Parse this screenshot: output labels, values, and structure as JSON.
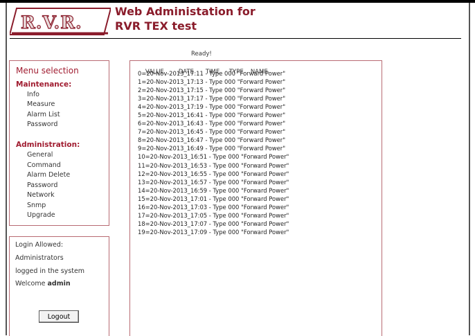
{
  "brand": {
    "logo_text": "R.V.R."
  },
  "header": {
    "title_line1": "Web Administation for",
    "title_line2": "RVR TEX test"
  },
  "status": "Ready!",
  "menu": {
    "title": "Menu selection",
    "maintenance": {
      "heading": "Maintenance:",
      "items": [
        "Info",
        "Measure",
        "Alarm List",
        "Password"
      ]
    },
    "administration": {
      "heading": "Administration:",
      "items": [
        "General",
        "Command",
        "Alarm Delete",
        "Password",
        "Network",
        "Snmp",
        "Upgrade"
      ]
    }
  },
  "login": {
    "line1": "Login Allowed:",
    "line2": "Administrators",
    "line3": "logged in the system",
    "welcome_prefix": "Welcome",
    "username": "admin",
    "logout_label": "Logout"
  },
  "log": {
    "columns": [
      "VALUE",
      "DATE",
      "TIME",
      "TYPE",
      "NAME"
    ],
    "rows": [
      "0=20-Nov-2013_17:11 - Type 000 \"Forward Power\"",
      "1=20-Nov-2013_17:13 - Type 000 \"Forward Power\"",
      "2=20-Nov-2013_17:15 - Type 000 \"Forward Power\"",
      "3=20-Nov-2013_17:17 - Type 000 \"Forward Power\"",
      "4=20-Nov-2013_17:19 - Type 000 \"Forward Power\"",
      "5=20-Nov-2013_16:41 - Type 000 \"Forward Power\"",
      "6=20-Nov-2013_16:43 - Type 000 \"Forward Power\"",
      "7=20-Nov-2013_16:45 - Type 000 \"Forward Power\"",
      "8=20-Nov-2013_16:47 - Type 000 \"Forward Power\"",
      "9=20-Nov-2013_16:49 - Type 000 \"Forward Power\"",
      "10=20-Nov-2013_16:51 - Type 000 \"Forward Power\"",
      "11=20-Nov-2013_16:53 - Type 000 \"Forward Power\"",
      "12=20-Nov-2013_16:55 - Type 000 \"Forward Power\"",
      "13=20-Nov-2013_16:57 - Type 000 \"Forward Power\"",
      "14=20-Nov-2013_16:59 - Type 000 \"Forward Power\"",
      "15=20-Nov-2013_17:01 - Type 000 \"Forward Power\"",
      "16=20-Nov-2013_17:03 - Type 000 \"Forward Power\"",
      "17=20-Nov-2013_17:05 - Type 000 \"Forward Power\"",
      "18=20-Nov-2013_17:07 - Type 000 \"Forward Power\"",
      "19=20-Nov-2013_17:09 - Type 000 \"Forward Power\""
    ]
  },
  "colors": {
    "brand": "#8a1c2b",
    "panel_border": "#b86a72",
    "section_heading": "#a01c30"
  }
}
